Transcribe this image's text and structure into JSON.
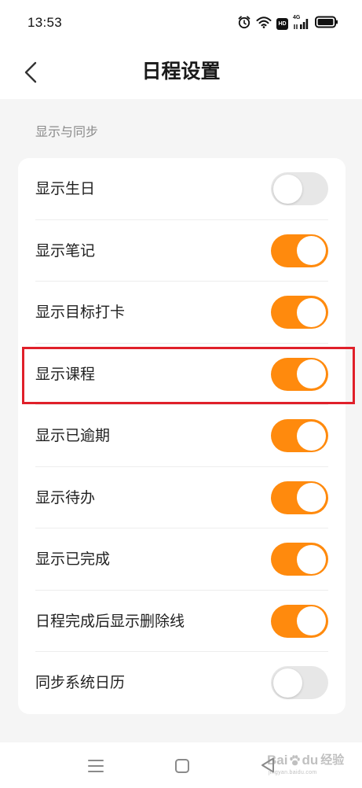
{
  "status_bar": {
    "time": "13:53",
    "hd_label": "HD",
    "network_label": "4G",
    "icons": [
      "alarm-icon",
      "wifi-icon",
      "hd-icon",
      "signal-icon",
      "battery-icon"
    ]
  },
  "header": {
    "title": "日程设置",
    "back_icon": "chevron-left-icon"
  },
  "section": {
    "label": "显示与同步"
  },
  "settings": [
    {
      "label": "显示生日",
      "enabled": false
    },
    {
      "label": "显示笔记",
      "enabled": true
    },
    {
      "label": "显示目标打卡",
      "enabled": true
    },
    {
      "label": "显示课程",
      "enabled": true
    },
    {
      "label": "显示已逾期",
      "enabled": true
    },
    {
      "label": "显示待办",
      "enabled": true
    },
    {
      "label": "显示已完成",
      "enabled": true
    },
    {
      "label": "日程完成后显示删除线",
      "enabled": true
    },
    {
      "label": "同步系统日历",
      "enabled": false
    }
  ],
  "highlight": {
    "item_index": 3,
    "color": "#E0202A"
  },
  "colors": {
    "accent": "#FF8A0D",
    "toggle_off": "#E7E7E7",
    "page_background": "#F5F5F5",
    "card_background": "#FFFFFF"
  },
  "nav_bar": {
    "icons": [
      "menu-icon",
      "home-icon",
      "back-triangle-icon"
    ]
  },
  "watermark": {
    "brand_left": "Bai",
    "brand_right": "du",
    "suffix": "经验",
    "url": "jingyan.baidu.com"
  }
}
